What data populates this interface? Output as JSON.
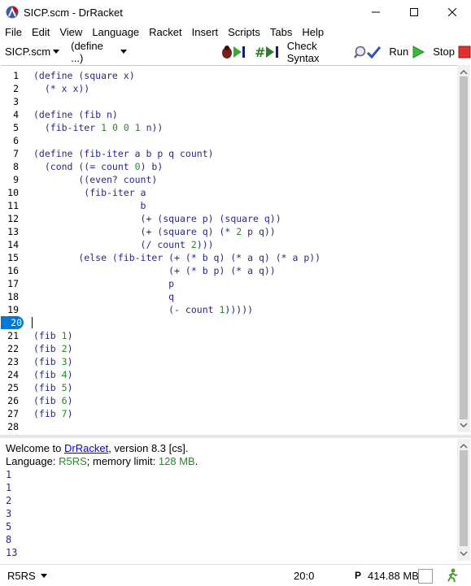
{
  "window": {
    "title": "SICP.scm - DrRacket",
    "minimize": "—",
    "maximize": "☐",
    "close": "✕"
  },
  "menu": [
    "File",
    "Edit",
    "View",
    "Language",
    "Racket",
    "Insert",
    "Scripts",
    "Tabs",
    "Help"
  ],
  "toolbar": {
    "file_dropdown": "SICP.scm",
    "define_dropdown": "(define ...)",
    "check_syntax": "Check Syntax",
    "run": "Run",
    "stop": "Stop"
  },
  "editor": {
    "highlighted_line": 20,
    "lines": [
      {
        "n": "1",
        "text": "(define (square x)"
      },
      {
        "n": "2",
        "text": "  (* x x))"
      },
      {
        "n": "3",
        "text": ""
      },
      {
        "n": "4",
        "text": "(define (fib n)"
      },
      {
        "n": "5",
        "text": "  (fib-iter 1 0 0 1 n))"
      },
      {
        "n": "6",
        "text": ""
      },
      {
        "n": "7",
        "text": "(define (fib-iter a b p q count)"
      },
      {
        "n": "8",
        "text": "  (cond ((= count 0) b)"
      },
      {
        "n": "9",
        "text": "        ((even? count)"
      },
      {
        "n": "10",
        "text": "         (fib-iter a"
      },
      {
        "n": "11",
        "text": "                   b"
      },
      {
        "n": "12",
        "text": "                   (+ (square p) (square q))"
      },
      {
        "n": "13",
        "text": "                   (+ (square q) (* 2 p q))"
      },
      {
        "n": "14",
        "text": "                   (/ count 2)))"
      },
      {
        "n": "15",
        "text": "        (else (fib-iter (+ (* b q) (* a q) (* a p))"
      },
      {
        "n": "16",
        "text": "                        (+ (* b p) (* a q))"
      },
      {
        "n": "17",
        "text": "                        p"
      },
      {
        "n": "18",
        "text": "                        q"
      },
      {
        "n": "19",
        "text": "                        (- count 1)))))"
      },
      {
        "n": "20",
        "text": ""
      },
      {
        "n": "21",
        "text": "(fib 1)"
      },
      {
        "n": "22",
        "text": "(fib 2)"
      },
      {
        "n": "23",
        "text": "(fib 3)"
      },
      {
        "n": "24",
        "text": "(fib 4)"
      },
      {
        "n": "25",
        "text": "(fib 5)"
      },
      {
        "n": "26",
        "text": "(fib 6)"
      },
      {
        "n": "27",
        "text": "(fib 7)"
      },
      {
        "n": "28",
        "text": ""
      }
    ]
  },
  "repl": {
    "welcome_prefix": "Welcome to ",
    "welcome_link": "DrRacket",
    "welcome_suffix": ", version 8.3 [cs].",
    "language_prefix": "Language: ",
    "language_name": "R5RS",
    "language_mid": "; memory limit: ",
    "memory_limit": "128 MB",
    "language_end": ".",
    "outputs": [
      "1",
      "1",
      "2",
      "3",
      "5",
      "8",
      "13"
    ]
  },
  "status": {
    "language": "R5RS",
    "position": "20:0",
    "p_label": "P",
    "memory": "414.88 MB"
  },
  "colors": {
    "code": "#26268c",
    "number": "#228b22",
    "repl_output": "#26268c",
    "highlight": "#0078d7",
    "link": "#0000ee"
  }
}
